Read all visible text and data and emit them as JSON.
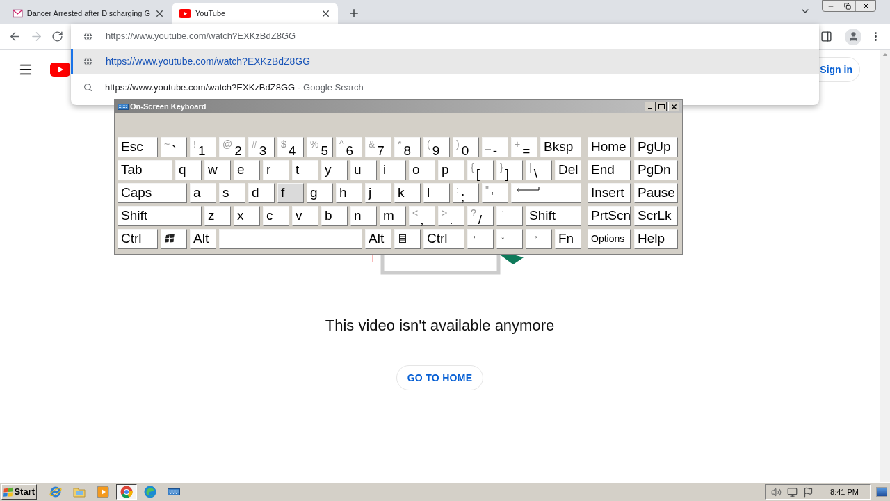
{
  "browser": {
    "tabs": [
      {
        "title": "Dancer Arrested after Discharging G",
        "selected": false
      },
      {
        "title": "YouTube",
        "selected": true
      }
    ],
    "address_bar": {
      "value": "https://www.youtube.com/watch?EXKzBdZ8GG"
    },
    "suggestions": [
      {
        "kind": "url",
        "text": "https://www.youtube.com/watch?EXKzBdZ8GG",
        "selected": true
      },
      {
        "kind": "search",
        "text": "https://www.youtube.com/watch?EXKzBdZ8GG",
        "suffix": "- Google Search",
        "selected": false
      }
    ]
  },
  "page": {
    "sign_in": "Sign in",
    "message": "This video isn't available anymore",
    "home_button": "GO TO HOME"
  },
  "keyboard": {
    "title": "On-Screen Keyboard",
    "main_rows": [
      [
        {
          "kind": "text",
          "main": "Esc",
          "hovered": false
        },
        {
          "kind": "dual",
          "top": "~",
          "main": "`",
          "hovered": false
        },
        {
          "kind": "dual",
          "top": "!",
          "main": "1",
          "hovered": false
        },
        {
          "kind": "dual",
          "top": "@",
          "main": "2",
          "hovered": false
        },
        {
          "kind": "dual",
          "top": "#",
          "main": "3",
          "hovered": false
        },
        {
          "kind": "dual",
          "top": "$",
          "main": "4",
          "hovered": false
        },
        {
          "kind": "dual",
          "top": "%",
          "main": "5",
          "hovered": false
        },
        {
          "kind": "dual",
          "top": "^",
          "main": "6",
          "hovered": false
        },
        {
          "kind": "dual",
          "top": "&",
          "main": "7",
          "hovered": false
        },
        {
          "kind": "dual",
          "top": "*",
          "main": "8",
          "hovered": false
        },
        {
          "kind": "dual",
          "top": "(",
          "main": "9",
          "hovered": false
        },
        {
          "kind": "dual",
          "top": ")",
          "main": "0",
          "hovered": false
        },
        {
          "kind": "dual",
          "top": "_",
          "main": "-",
          "hovered": false
        },
        {
          "kind": "dual",
          "top": "+",
          "main": "=",
          "hovered": false
        },
        {
          "kind": "text",
          "main": "Bksp",
          "hovered": false
        }
      ],
      [
        {
          "kind": "text",
          "main": "Tab",
          "hovered": false
        },
        {
          "kind": "letter",
          "main": "q",
          "hovered": false
        },
        {
          "kind": "letter",
          "main": "w",
          "hovered": false
        },
        {
          "kind": "letter",
          "main": "e",
          "hovered": false
        },
        {
          "kind": "letter",
          "main": "r",
          "hovered": false
        },
        {
          "kind": "letter",
          "main": "t",
          "hovered": false
        },
        {
          "kind": "letter",
          "main": "y",
          "hovered": false
        },
        {
          "kind": "letter",
          "main": "u",
          "hovered": false
        },
        {
          "kind": "letter",
          "main": "i",
          "hovered": false
        },
        {
          "kind": "letter",
          "main": "o",
          "hovered": false
        },
        {
          "kind": "letter",
          "main": "p",
          "hovered": false
        },
        {
          "kind": "dual",
          "top": "{",
          "main": "[",
          "hovered": false
        },
        {
          "kind": "dual",
          "top": "}",
          "main": "]",
          "hovered": false
        },
        {
          "kind": "dual",
          "top": "|",
          "main": "\\",
          "hovered": false
        },
        {
          "kind": "text",
          "main": "Del",
          "hovered": false
        }
      ],
      [
        {
          "kind": "text",
          "main": "Caps",
          "hovered": false
        },
        {
          "kind": "letter",
          "main": "a",
          "hovered": false
        },
        {
          "kind": "letter",
          "main": "s",
          "hovered": false
        },
        {
          "kind": "letter",
          "main": "d",
          "hovered": false
        },
        {
          "kind": "letter",
          "main": "f",
          "hovered": true
        },
        {
          "kind": "letter",
          "main": "g",
          "hovered": false
        },
        {
          "kind": "letter",
          "main": "h",
          "hovered": false
        },
        {
          "kind": "letter",
          "main": "j",
          "hovered": false
        },
        {
          "kind": "letter",
          "main": "k",
          "hovered": false
        },
        {
          "kind": "letter",
          "main": "l",
          "hovered": false
        },
        {
          "kind": "dual",
          "top": ":",
          "main": ";",
          "hovered": false
        },
        {
          "kind": "dual",
          "top": "\"",
          "main": "'",
          "hovered": false
        },
        {
          "kind": "enter",
          "hovered": false
        }
      ],
      [
        {
          "kind": "text",
          "main": "Shift",
          "hovered": false
        },
        {
          "kind": "letter",
          "main": "z",
          "hovered": false
        },
        {
          "kind": "letter",
          "main": "x",
          "hovered": false
        },
        {
          "kind": "letter",
          "main": "c",
          "hovered": false
        },
        {
          "kind": "letter",
          "main": "v",
          "hovered": false
        },
        {
          "kind": "letter",
          "main": "b",
          "hovered": false
        },
        {
          "kind": "letter",
          "main": "n",
          "hovered": false
        },
        {
          "kind": "letter",
          "main": "m",
          "hovered": false
        },
        {
          "kind": "dual",
          "top": "<",
          "main": ",",
          "hovered": false
        },
        {
          "kind": "dual",
          "top": ">",
          "main": ".",
          "hovered": false
        },
        {
          "kind": "dual",
          "top": "?",
          "main": "/",
          "hovered": false
        },
        {
          "kind": "arrow",
          "main": "↑",
          "hovered": false
        },
        {
          "kind": "text",
          "main": "Shift",
          "hovered": false
        }
      ],
      [
        {
          "kind": "text",
          "main": "Ctrl",
          "hovered": false
        },
        {
          "kind": "windows",
          "hovered": false
        },
        {
          "kind": "text",
          "main": "Alt",
          "hovered": false
        },
        {
          "kind": "space",
          "hovered": false
        },
        {
          "kind": "text",
          "main": "Alt",
          "hovered": false
        },
        {
          "kind": "menu",
          "hovered": false
        },
        {
          "kind": "text",
          "main": "Ctrl",
          "hovered": false
        },
        {
          "kind": "arrow",
          "main": "←",
          "hovered": false
        },
        {
          "kind": "arrow",
          "main": "↓",
          "hovered": false
        },
        {
          "kind": "arrow",
          "main": "→",
          "hovered": false
        },
        {
          "kind": "text",
          "main": "Fn",
          "hovered": false
        }
      ]
    ],
    "side_rows": [
      [
        {
          "kind": "text",
          "main": "Home",
          "hovered": false
        },
        {
          "kind": "text",
          "main": "PgUp",
          "hovered": false
        }
      ],
      [
        {
          "kind": "text",
          "main": "End",
          "hovered": false
        },
        {
          "kind": "text",
          "main": "PgDn",
          "hovered": false
        }
      ],
      [
        {
          "kind": "text",
          "main": "Insert",
          "hovered": false
        },
        {
          "kind": "text",
          "main": "Pause",
          "hovered": false
        }
      ],
      [
        {
          "kind": "text",
          "main": "PrtScn",
          "hovered": false
        },
        {
          "kind": "text",
          "main": "ScrLk",
          "hovered": false
        }
      ],
      [
        {
          "kind": "small",
          "main": "Options",
          "hovered": false
        },
        {
          "kind": "text",
          "main": "Help",
          "hovered": false
        }
      ]
    ]
  },
  "taskbar": {
    "start": "Start",
    "apps": [
      {
        "kind": "ie",
        "selected": false
      },
      {
        "kind": "folder",
        "selected": false
      },
      {
        "kind": "media",
        "selected": false
      },
      {
        "kind": "chrome",
        "selected": true
      },
      {
        "kind": "edge",
        "selected": false
      },
      {
        "kind": "keyboard",
        "selected": false
      }
    ],
    "clock": "8:41 PM"
  }
}
